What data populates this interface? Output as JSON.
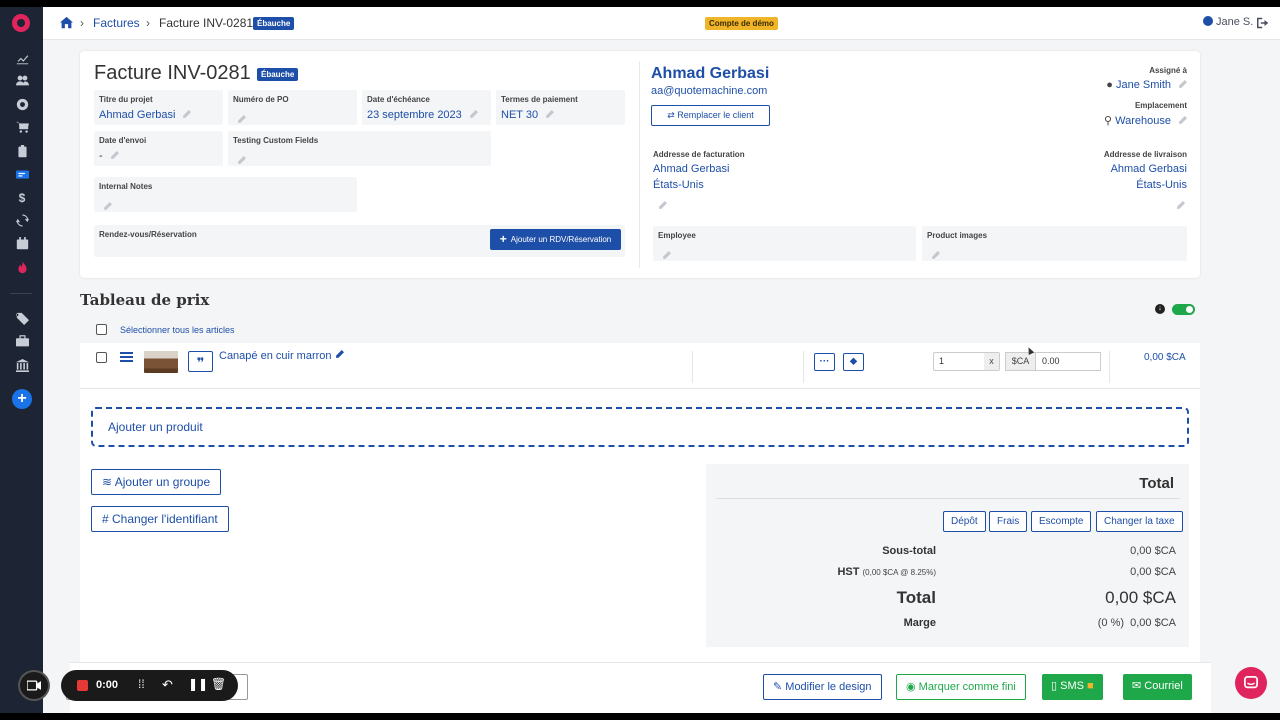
{
  "breadcrumb": {
    "parent": "Factures",
    "current": "Facture INV-0281",
    "status_badge": "Ébauche"
  },
  "demo_badge": "Compte de démo",
  "user": {
    "name": "Jane S."
  },
  "invoice": {
    "title": "Facture INV-0281",
    "status_badge": "Ébauche",
    "fields": {
      "project_title": {
        "label": "Titre du projet",
        "value": "Ahmad Gerbasi"
      },
      "po_number": {
        "label": "Numéro de PO",
        "value": ""
      },
      "due_date": {
        "label": "Date d'échéance",
        "value": "23 septembre 2023"
      },
      "payment_terms": {
        "label": "Termes de paiement",
        "value": "NET 30"
      },
      "send_date": {
        "label": "Date d'envoi",
        "value": "-"
      },
      "custom_fields": {
        "label": "Testing Custom Fields",
        "value": ""
      },
      "internal_notes": {
        "label": "Internal Notes",
        "value": ""
      },
      "appointments": {
        "label": "Rendez-vous/Réservation"
      }
    },
    "add_appointment_button": "Ajouter un RDV/Réservation"
  },
  "client": {
    "name": "Ahmad Gerbasi",
    "email": "aa@quotemachine.com",
    "replace_button": "Remplacer le client",
    "assigned_label": "Assigné à",
    "assigned_value": "Jane Smith",
    "location_label": "Emplacement",
    "location_value": "Warehouse",
    "billing": {
      "label": "Addresse de facturation",
      "name": "Ahmad Gerbasi",
      "country": "États-Unis"
    },
    "shipping": {
      "label": "Addresse de livraison",
      "name": "Ahmad Gerbasi",
      "country": "États-Unis"
    },
    "employee_label": "Employee",
    "product_images_label": "Product images"
  },
  "price_table": {
    "title": "Tableau de prix",
    "select_all": "Sélectionner tous les articles",
    "items": [
      {
        "name": "Canapé en cuir marron",
        "quantity": "1",
        "qty_x": "x",
        "currency": "$CA",
        "unit_price": "0.00",
        "total": "0,00 $CA"
      }
    ],
    "add_product": "Ajouter un produit",
    "add_group": "Ajouter un groupe",
    "change_identifier": "Changer l'identifiant"
  },
  "totals": {
    "header": "Total",
    "buttons": [
      "Dépôt",
      "Frais",
      "Escompte",
      "Changer la taxe"
    ],
    "subtotal_label": "Sous-total",
    "subtotal_value": "0,00 $CA",
    "tax_label": "HST",
    "tax_detail": "(0,00 $CA @ 8.25%)",
    "tax_value": "0,00 $CA",
    "total_label": "Total",
    "total_value": "0,00 $CA",
    "margin_label": "Marge",
    "margin_value": "(0 %)  0,00 $CA"
  },
  "bottom_actions": {
    "modify_design": "Modifier le design",
    "mark_done": "Marquer comme fini",
    "sms": "SMS",
    "email": "Courriel"
  },
  "recorder": {
    "time": "0:00"
  },
  "colors": {
    "primary": "#1e4fa8",
    "sidebar": "#1d2433",
    "success": "#1fa84a",
    "demo_badge": "#f0b429",
    "brand": "#e0245e"
  }
}
